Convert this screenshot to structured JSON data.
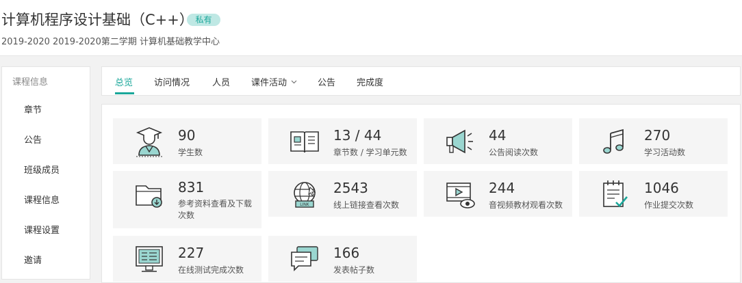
{
  "header": {
    "title": "计算机程序设计基础（C++）",
    "badge": "私有",
    "subtitle": "2019-2020 2019-2020第二学期 计算机基础教学中心"
  },
  "sidebar": {
    "title": "课程信息",
    "items": [
      {
        "label": "章节"
      },
      {
        "label": "公告"
      },
      {
        "label": "班级成员"
      },
      {
        "label": "课程信息"
      },
      {
        "label": "课程设置"
      },
      {
        "label": "邀请"
      }
    ]
  },
  "tabs": [
    {
      "label": "总览"
    },
    {
      "label": "访问情况"
    },
    {
      "label": "人员"
    },
    {
      "label": "课件活动"
    },
    {
      "label": "公告"
    },
    {
      "label": "完成度"
    }
  ],
  "stats": [
    {
      "value": "90",
      "label": "学生数",
      "icon": "student-icon"
    },
    {
      "value": "13 / 44",
      "label": "章节数 / 学习单元数",
      "icon": "book-icon"
    },
    {
      "value": "44",
      "label": "公告阅读次数",
      "icon": "megaphone-icon"
    },
    {
      "value": "270",
      "label": "学习活动数",
      "icon": "music-note-icon"
    },
    {
      "value": "831",
      "label": "参考资料查看及下载次数",
      "icon": "folder-download-icon"
    },
    {
      "value": "2543",
      "label": "线上链接查看次数",
      "icon": "globe-link-icon"
    },
    {
      "value": "244",
      "label": "音视频教材观看次数",
      "icon": "video-view-icon"
    },
    {
      "value": "1046",
      "label": "作业提交次数",
      "icon": "homework-icon"
    },
    {
      "value": "227",
      "label": "在线测试完成次数",
      "icon": "online-test-icon"
    },
    {
      "value": "166",
      "label": "发表帖子数",
      "icon": "chat-post-icon"
    }
  ],
  "colors": {
    "accent": "#1aa79a",
    "badge_bg": "#bfe8e4",
    "card_bg": "#f5f5f5"
  }
}
